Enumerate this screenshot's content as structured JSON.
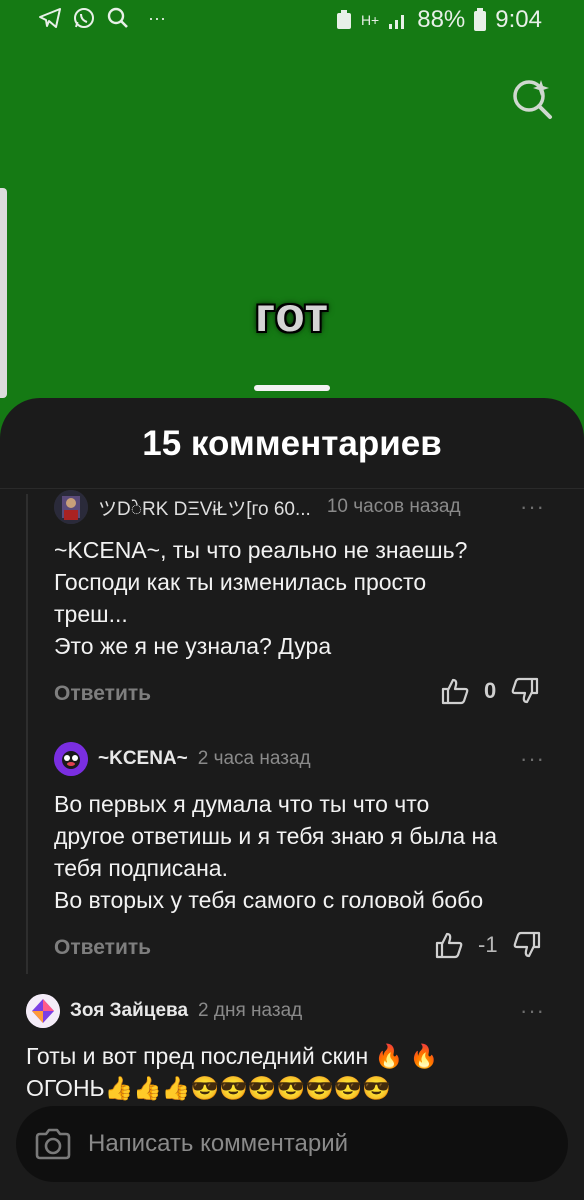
{
  "status_bar": {
    "battery_percent": "88%",
    "time": "9:04",
    "network": "H+",
    "left_icons": [
      "telegram-icon",
      "whatsapp-icon",
      "search-icon",
      "more-dots-icon"
    ],
    "more_dots": "···"
  },
  "video": {
    "caption": "гот"
  },
  "comments_sheet": {
    "title": "15 комментариев",
    "comments": [
      {
        "author": "ツDेRK DΞ͏VɨŁツ[го 60...",
        "time": "10 часов назад",
        "text": "~KCENA~, ты что реально не знаешь?\nГосподи как ты изменилась просто\nтреш...\nЭто же я не узнала? Дура",
        "reply_label": "Ответить",
        "score": "0",
        "more": "···"
      },
      {
        "author": "~KCENA~",
        "time": "2 часа назад",
        "text": "Во первых я думала что ты что что\nдругое ответишь и я тебя знаю я была на\nтебя подписана.\nВо вторых у тебя самого с головой бобо",
        "reply_label": "Ответить",
        "score": "-1",
        "more": "···"
      },
      {
        "author": "Зоя Зайцева",
        "time": "2 дня назад",
        "text": "Готы и вот пред последний скин 🔥 🔥\nОГОНЬ👍👍👍😎😎😎😎😎😎😎",
        "more": "···"
      }
    ]
  },
  "composer": {
    "placeholder": "Написать комментарий"
  },
  "colors": {
    "video_bg": "#157a14",
    "sheet_bg": "#1b1b1b",
    "composer_bg": "#0f0f0f",
    "muted_text": "#8a8a8a"
  }
}
